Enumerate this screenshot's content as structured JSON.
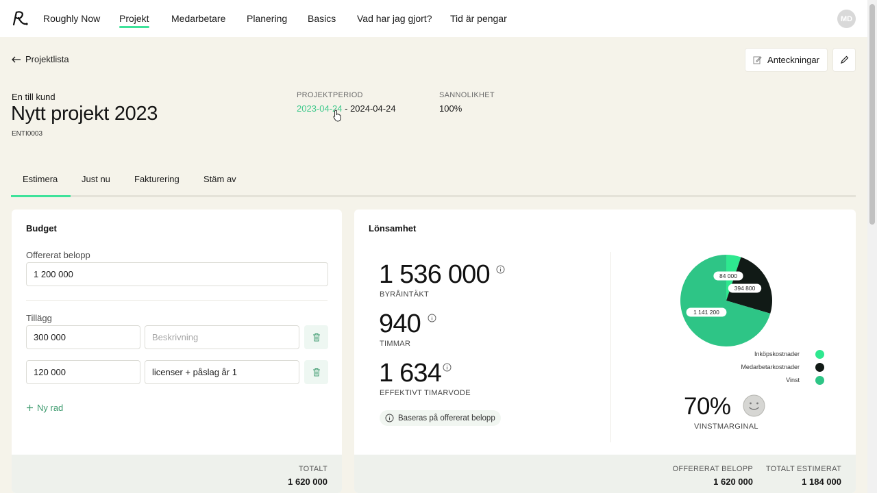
{
  "nav": {
    "items": [
      "Roughly Now",
      "Projekt",
      "Medarbetare",
      "Planering",
      "Basics",
      "Vad har jag gjort?",
      "Tid är pengar"
    ],
    "avatar_initials": "MD"
  },
  "header": {
    "back_label": "Projektlista",
    "notes_label": "Anteckningar",
    "customer": "En till kund",
    "title": "Nytt projekt 2023",
    "code": "ENTI0003",
    "period_label": "PROJEKTPERIOD",
    "period_start": "2023-04-24",
    "period_separator": " - ",
    "period_end": "2024-04-24",
    "probability_label": "SANNOLIKHET",
    "probability_value": "100%"
  },
  "tabs": [
    "Estimera",
    "Just nu",
    "Fakturering",
    "Stäm av"
  ],
  "budget": {
    "title": "Budget",
    "offered_label": "Offererat belopp",
    "offered_value": "1 200 000",
    "additions_label": "Tillägg",
    "rows": [
      {
        "amount": "300 000",
        "description": "",
        "description_placeholder": "Beskrivning"
      },
      {
        "amount": "120 000",
        "description": "licenser + påslag år 1",
        "description_placeholder": "Beskrivning"
      }
    ],
    "add_row_label": "Ny rad",
    "total_label": "TOTALT",
    "total_value": "1 620 000"
  },
  "profitability": {
    "title": "Lönsamhet",
    "revenue_value": "1 536 000",
    "revenue_label": "BYRÅINTÄKT",
    "hours_value": "940",
    "hours_label": "TIMMAR",
    "rate_value": "1 634",
    "rate_label": "EFFEKTIVT TIMARVODE",
    "basis_note": "Baseras på offererat belopp",
    "margin_value": "70%",
    "margin_label": "VINSTMARGINAL",
    "footer_offered_label": "OFFERERAT BELOPP",
    "footer_offered_value": "1 620 000",
    "footer_estimated_label": "TOTALT ESTIMERAT",
    "footer_estimated_value": "1 184 000"
  },
  "chart_data": {
    "type": "pie",
    "slices": [
      {
        "name": "Inköpskostnader",
        "value": 84000,
        "label": "84 000",
        "color": "#2ee88f"
      },
      {
        "name": "Medarbetarkostnader",
        "value": 394800,
        "label": "394 800",
        "color": "#111a16"
      },
      {
        "name": "Vinst",
        "value": 1141200,
        "label": "1 141 200",
        "color": "#2ec586"
      }
    ],
    "legend_position": "bottom-right"
  },
  "colors": {
    "accent": "#3ee29a",
    "link": "#3ec98b",
    "background": "#f5f3ea"
  }
}
